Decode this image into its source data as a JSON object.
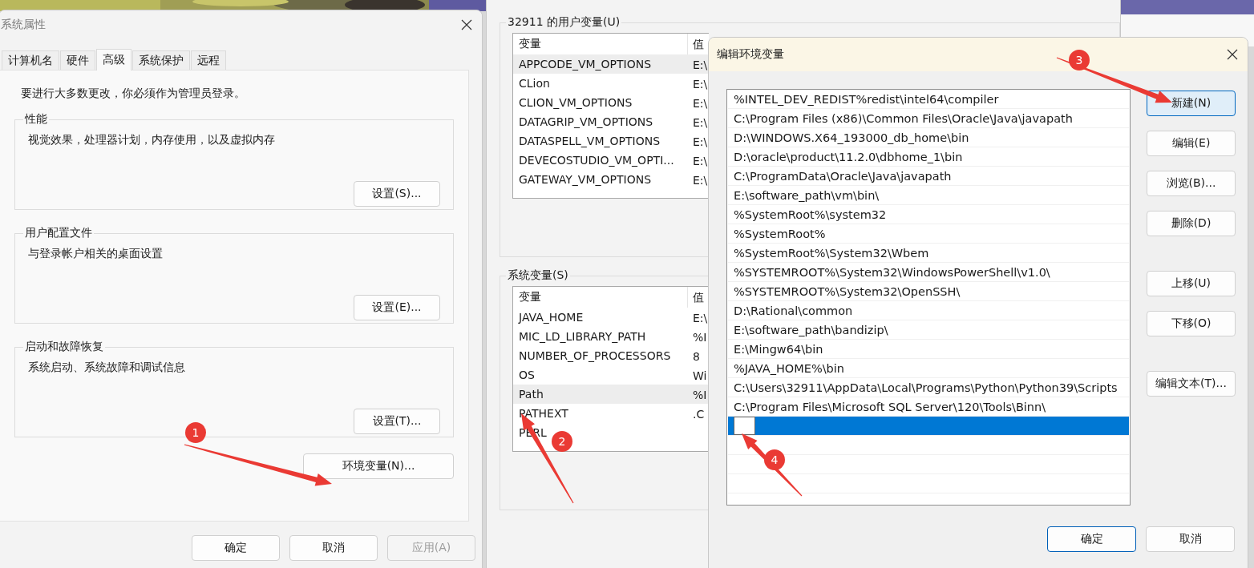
{
  "system_properties": {
    "title": "系统属性",
    "tabs": [
      {
        "label": "计算机名",
        "selected": false
      },
      {
        "label": "硬件",
        "selected": false
      },
      {
        "label": "高级",
        "selected": true
      },
      {
        "label": "系统保护",
        "selected": false
      },
      {
        "label": "远程",
        "selected": false
      }
    ],
    "admin_note": "要进行大多数更改，你必须作为管理员登录。",
    "groups": [
      {
        "title": "性能",
        "description": "视觉效果，处理器计划，内存使用，以及虚拟内存",
        "button": "设置(S)..."
      },
      {
        "title": "用户配置文件",
        "description": "与登录帐户相关的桌面设置",
        "button": "设置(E)..."
      },
      {
        "title": "启动和故障恢复",
        "description": "系统启动、系统故障和调试信息",
        "button": "设置(T)..."
      }
    ],
    "env_button": "环境变量(N)...",
    "buttons": [
      {
        "label": "确定",
        "disabled": false
      },
      {
        "label": "取消",
        "disabled": false
      },
      {
        "label": "应用(A)",
        "disabled": true
      }
    ]
  },
  "environment_variables": {
    "user_group": {
      "title": "32911 的用户变量(U)",
      "columns": [
        "变量",
        "值"
      ],
      "rows": [
        {
          "name": "APPCODE_VM_OPTIONS",
          "value": "E:\\",
          "selected": true
        },
        {
          "name": "CLion",
          "value": "E:\\",
          "selected": false
        },
        {
          "name": "CLION_VM_OPTIONS",
          "value": "E:\\",
          "selected": false
        },
        {
          "name": "DATAGRIP_VM_OPTIONS",
          "value": "E:\\",
          "selected": false
        },
        {
          "name": "DATASPELL_VM_OPTIONS",
          "value": "E:\\",
          "selected": false
        },
        {
          "name": "DEVECOSTUDIO_VM_OPTI...",
          "value": "E:\\",
          "selected": false
        },
        {
          "name": "GATEWAY_VM_OPTIONS",
          "value": "E:\\",
          "selected": false
        }
      ]
    },
    "system_group": {
      "title": "系统变量(S)",
      "columns": [
        "变量",
        "值"
      ],
      "rows": [
        {
          "name": "JAVA_HOME",
          "value": "E:\\",
          "selected": false
        },
        {
          "name": "MIC_LD_LIBRARY_PATH",
          "value": "%I",
          "selected": false
        },
        {
          "name": "NUMBER_OF_PROCESSORS",
          "value": "8",
          "selected": false
        },
        {
          "name": "OS",
          "value": "Wi",
          "selected": false
        },
        {
          "name": "Path",
          "value": "%I",
          "selected": true
        },
        {
          "name": "PATHEXT",
          "value": ".C",
          "selected": false
        },
        {
          "name": "PERL",
          "selected": false
        }
      ]
    }
  },
  "edit_dialog": {
    "title": "编辑环境变量",
    "entries": [
      {
        "kind": "text",
        "text": "%INTEL_DEV_REDIST%redist\\intel64\\compiler",
        "selected": false
      },
      {
        "kind": "text",
        "text": "C:\\Program Files (x86)\\Common Files\\Oracle\\Java\\javapath",
        "selected": false
      },
      {
        "kind": "text",
        "text": "D:\\WINDOWS.X64_193000_db_home\\bin",
        "selected": false
      },
      {
        "kind": "text",
        "text": "D:\\oracle\\product\\11.2.0\\dbhome_1\\bin",
        "selected": false
      },
      {
        "kind": "text",
        "text": "C:\\ProgramData\\Oracle\\Java\\javapath",
        "selected": false
      },
      {
        "kind": "text",
        "text": "E:\\software_path\\vm\\bin\\",
        "selected": false
      },
      {
        "kind": "text",
        "text": "%SystemRoot%\\system32",
        "selected": false
      },
      {
        "kind": "text",
        "text": "%SystemRoot%",
        "selected": false
      },
      {
        "kind": "text",
        "text": "%SystemRoot%\\System32\\Wbem",
        "selected": false
      },
      {
        "kind": "text",
        "text": "%SYSTEMROOT%\\System32\\WindowsPowerShell\\v1.0\\",
        "selected": false
      },
      {
        "kind": "text",
        "text": "%SYSTEMROOT%\\System32\\OpenSSH\\",
        "selected": false
      },
      {
        "kind": "text",
        "text": "D:\\Rational\\common",
        "selected": false
      },
      {
        "kind": "text",
        "text": "E:\\software_path\\bandizip\\",
        "selected": false
      },
      {
        "kind": "text",
        "text": "E:\\Mingw64\\bin",
        "selected": false
      },
      {
        "kind": "text",
        "text": "%JAVA_HOME%\\bin",
        "selected": false
      },
      {
        "kind": "text",
        "text": "C:\\Users\\32911\\AppData\\Local\\Programs\\Python\\Python39\\Scripts",
        "selected": false
      },
      {
        "kind": "text",
        "text": "C:\\Program Files\\Microsoft SQL Server\\120\\Tools\\Binn\\",
        "selected": false
      },
      {
        "kind": "input",
        "selected": true
      }
    ],
    "side_button_groups": [
      [
        {
          "label": "新建(N)",
          "focused": true
        },
        {
          "label": "编辑(E)",
          "focused": false
        },
        {
          "label": "浏览(B)...",
          "focused": false
        },
        {
          "label": "删除(D)",
          "focused": false
        }
      ],
      [
        {
          "label": "上移(U)",
          "focused": false
        },
        {
          "label": "下移(O)",
          "focused": false
        }
      ],
      [
        {
          "label": "编辑文本(T)...",
          "focused": false
        }
      ]
    ],
    "buttons": [
      {
        "label": "确定",
        "default": true
      },
      {
        "label": "取消",
        "default": false
      }
    ]
  },
  "annotations": [
    {
      "label": "1"
    },
    {
      "label": "2"
    },
    {
      "label": "3"
    },
    {
      "label": "4"
    }
  ]
}
